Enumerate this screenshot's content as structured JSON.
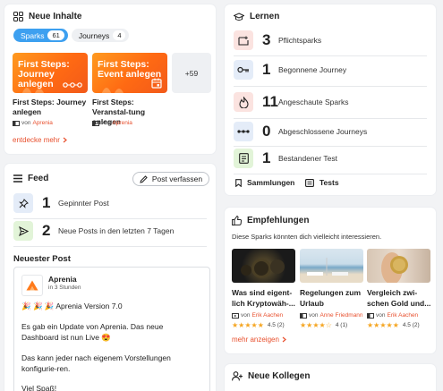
{
  "neue_inhalte": {
    "title": "Neue Inhalte",
    "tabs": [
      {
        "label": "Sparks",
        "count": "61"
      },
      {
        "label": "Journeys",
        "count": "4"
      }
    ],
    "items": [
      {
        "thumb_title": "First Steps: Journey anlegen",
        "title": "First Steps: Journey anlegen",
        "by": "von",
        "author": "Aprenia"
      },
      {
        "thumb_title": "First Steps: Event anlegen",
        "title": "First Steps: Veranstal-tung anlegen",
        "by": "von",
        "author": "Aprenia"
      }
    ],
    "more_count": "+59",
    "more_link": "entdecke mehr"
  },
  "lernen": {
    "title": "Lernen",
    "stats": [
      {
        "value": "3",
        "label": "Pflichtsparks",
        "icon": "pflicht-icon",
        "color": "#fbe3e0"
      },
      {
        "value": "1",
        "label": "Begonnene Journey",
        "icon": "key-icon",
        "color": "#e4ecf8"
      },
      {
        "value": "11",
        "label": "Angeschaute Sparks",
        "icon": "flame-icon",
        "color": "#fbe3e0"
      },
      {
        "value": "0",
        "label": "Abgeschlossene Journeys",
        "icon": "dots-icon",
        "color": "#e4ecf8"
      },
      {
        "value": "1",
        "label": "Bestandener Test",
        "icon": "test-icon",
        "color": "#e2f4d8"
      }
    ],
    "tabs": [
      {
        "label": "Sammlungen",
        "icon": "bookmark-icon"
      },
      {
        "label": "Tests",
        "icon": "list-icon"
      }
    ]
  },
  "feed": {
    "title": "Feed",
    "post_button": "Post verfassen",
    "stats": [
      {
        "value": "1",
        "label": "Gepinnter Post",
        "icon": "pin-icon",
        "color": "#e4ecf8"
      },
      {
        "value": "2",
        "label": "Neue Posts in den letzten 7 Tagen",
        "icon": "send-icon",
        "color": "#e2f4d8"
      }
    ],
    "newest_title": "Neuester Post",
    "post": {
      "author": "Aprenia",
      "time": "in 3 Stunden",
      "line1": "🎉 🎉 🎉 Aprenia Version 7.0",
      "line2": "Es gab ein Update von Aprenia. Das neue Dashboard ist nun Live 😍",
      "line3": "Das kann jeder nach eigenem Vorstellungen konfigurie-ren.",
      "line4": "Viel Spaß!"
    }
  },
  "empfehlungen": {
    "title": "Empfehlungen",
    "subtitle": "Diese Sparks könnten dich vielleicht interessieren.",
    "items": [
      {
        "title": "Was sind eigent-lich Kryptowäh-...",
        "by": "von",
        "author": "Erik Aachen",
        "stars": "★★★★★",
        "rating": "4.5 (2)"
      },
      {
        "title": "Regelungen zum Urlaub",
        "by": "von",
        "author": "Anne Friedmann",
        "stars": "★★★★☆",
        "rating": "4 (1)"
      },
      {
        "title": "Vergleich zwi-schen Gold und...",
        "by": "von",
        "author": "Erik Aachen",
        "stars": "★★★★★",
        "rating": "4.5 (2)"
      }
    ],
    "more_link": "mehr anzeigen"
  },
  "neue_kollegen": {
    "title": "Neue Kollegen"
  }
}
